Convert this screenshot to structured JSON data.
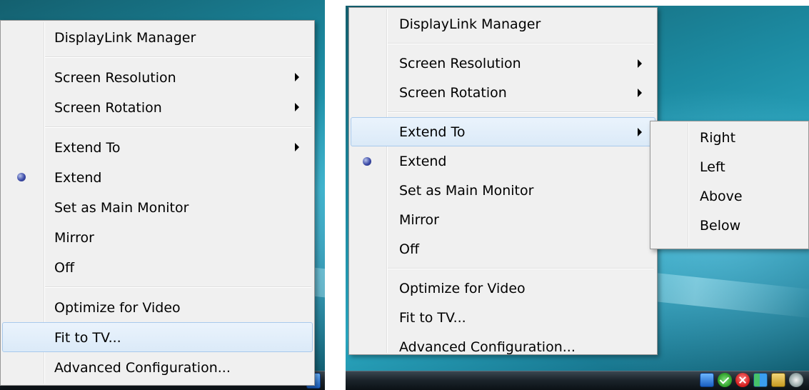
{
  "left_menu": {
    "items": [
      {
        "label": "DisplayLink Manager"
      },
      {
        "label": "Screen Resolution"
      },
      {
        "label": "Screen Rotation"
      },
      {
        "label": "Extend To"
      },
      {
        "label": "Extend"
      },
      {
        "label": "Set as Main Monitor"
      },
      {
        "label": "Mirror"
      },
      {
        "label": "Off"
      },
      {
        "label": "Optimize for Video"
      },
      {
        "label": "Fit to TV..."
      },
      {
        "label": "Advanced Configuration..."
      }
    ],
    "hovered": "Fit to TV...",
    "selected_radio": "Extend"
  },
  "right_menu": {
    "items": [
      {
        "label": "DisplayLink Manager"
      },
      {
        "label": "Screen Resolution"
      },
      {
        "label": "Screen Rotation"
      },
      {
        "label": "Extend To"
      },
      {
        "label": "Extend"
      },
      {
        "label": "Set as Main Monitor"
      },
      {
        "label": "Mirror"
      },
      {
        "label": "Off"
      },
      {
        "label": "Optimize for Video"
      },
      {
        "label": "Fit to TV..."
      },
      {
        "label": "Advanced Configuration..."
      }
    ],
    "hovered": "Extend To",
    "selected_radio": "Extend"
  },
  "submenu": {
    "items": [
      {
        "label": "Right"
      },
      {
        "label": "Left"
      },
      {
        "label": "Above"
      },
      {
        "label": "Below"
      }
    ]
  },
  "icons": {
    "submenu_arrow": "chevron-right-icon",
    "radio": "radio-selected-icon",
    "tray": [
      "network-icon",
      "security-check-icon",
      "security-alert-icon",
      "displaylink-monitor-icon",
      "volume-icon",
      "power-icon"
    ]
  },
  "colors": {
    "menu_background": "#f0f0f0",
    "menu_border": "#979797",
    "hover_background": "#dbeaf8",
    "hover_border": "#a8c9ec",
    "radio_dot": "#3d4ca8",
    "desktop": "#1c8aa1"
  }
}
